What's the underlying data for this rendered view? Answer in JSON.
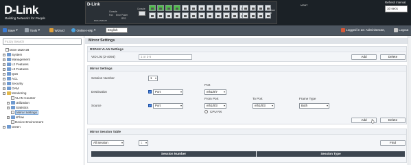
{
  "header": {
    "brand": "D-Link",
    "tagline": "Building Networks for People",
    "device_brand": "D-Link",
    "device_model": "DGS-1520-28",
    "led_labels": [
      "Console",
      "Fan",
      "Error",
      "Power",
      "RPS"
    ],
    "console_label": "Console",
    "mgmt_label": "MGMT",
    "stack_label": "Stack ID",
    "refresh_label": "Refresh Interval",
    "refresh_value": "10 secs"
  },
  "toolbar": {
    "save": "Save",
    "tools": "Tools",
    "wizard": "Wizard",
    "online_help": "Online Help",
    "language": "English",
    "logged_in": "Logged in as: Administrator,",
    "logout": "Logout"
  },
  "sidebar": {
    "search_placeholder": "Fuzzy Search",
    "root": "DGS-1520-28",
    "items": [
      "System",
      "Management",
      "L2 Features",
      "L3 Features",
      "QoS",
      "ACL",
      "Security",
      "OAM",
      "Monitoring"
    ],
    "monitoring_children": [
      "VLAN Counter",
      "Utilization",
      "Statistics",
      "Mirror Settings",
      "sFlow",
      "Device Environment"
    ],
    "green": "Green"
  },
  "main": {
    "title": "Mirror Settings",
    "rspan": {
      "title": "RSPAN VLAN Settings",
      "vid_label": "VID List (2-4094)",
      "vid_placeholder": "1 or 2-5",
      "add": "Add",
      "delete": "Delete"
    },
    "mirror": {
      "title": "Mirror Settings",
      "session_label": "Session Number",
      "session_value": "1",
      "destination_label": "Destination",
      "dest_type": "Port",
      "port_header": "Port",
      "dest_port": "eth1/0/7",
      "source_label": "Source",
      "src_type": "Port",
      "from_port_header": "From Port",
      "to_port_header": "To Port",
      "frame_type_header": "Frame Type",
      "from_port": "eth1/0/3",
      "to_port": "eth1/0/3",
      "frame_type": "Both",
      "cpu_rx": "CPU RX",
      "add": "Add",
      "delete": "Delete"
    },
    "session_table": {
      "title": "Mirror Session Table",
      "filter": "All Session",
      "filter_value": "1",
      "find": "Find",
      "columns": [
        "Session Number",
        "Session Type"
      ]
    }
  }
}
